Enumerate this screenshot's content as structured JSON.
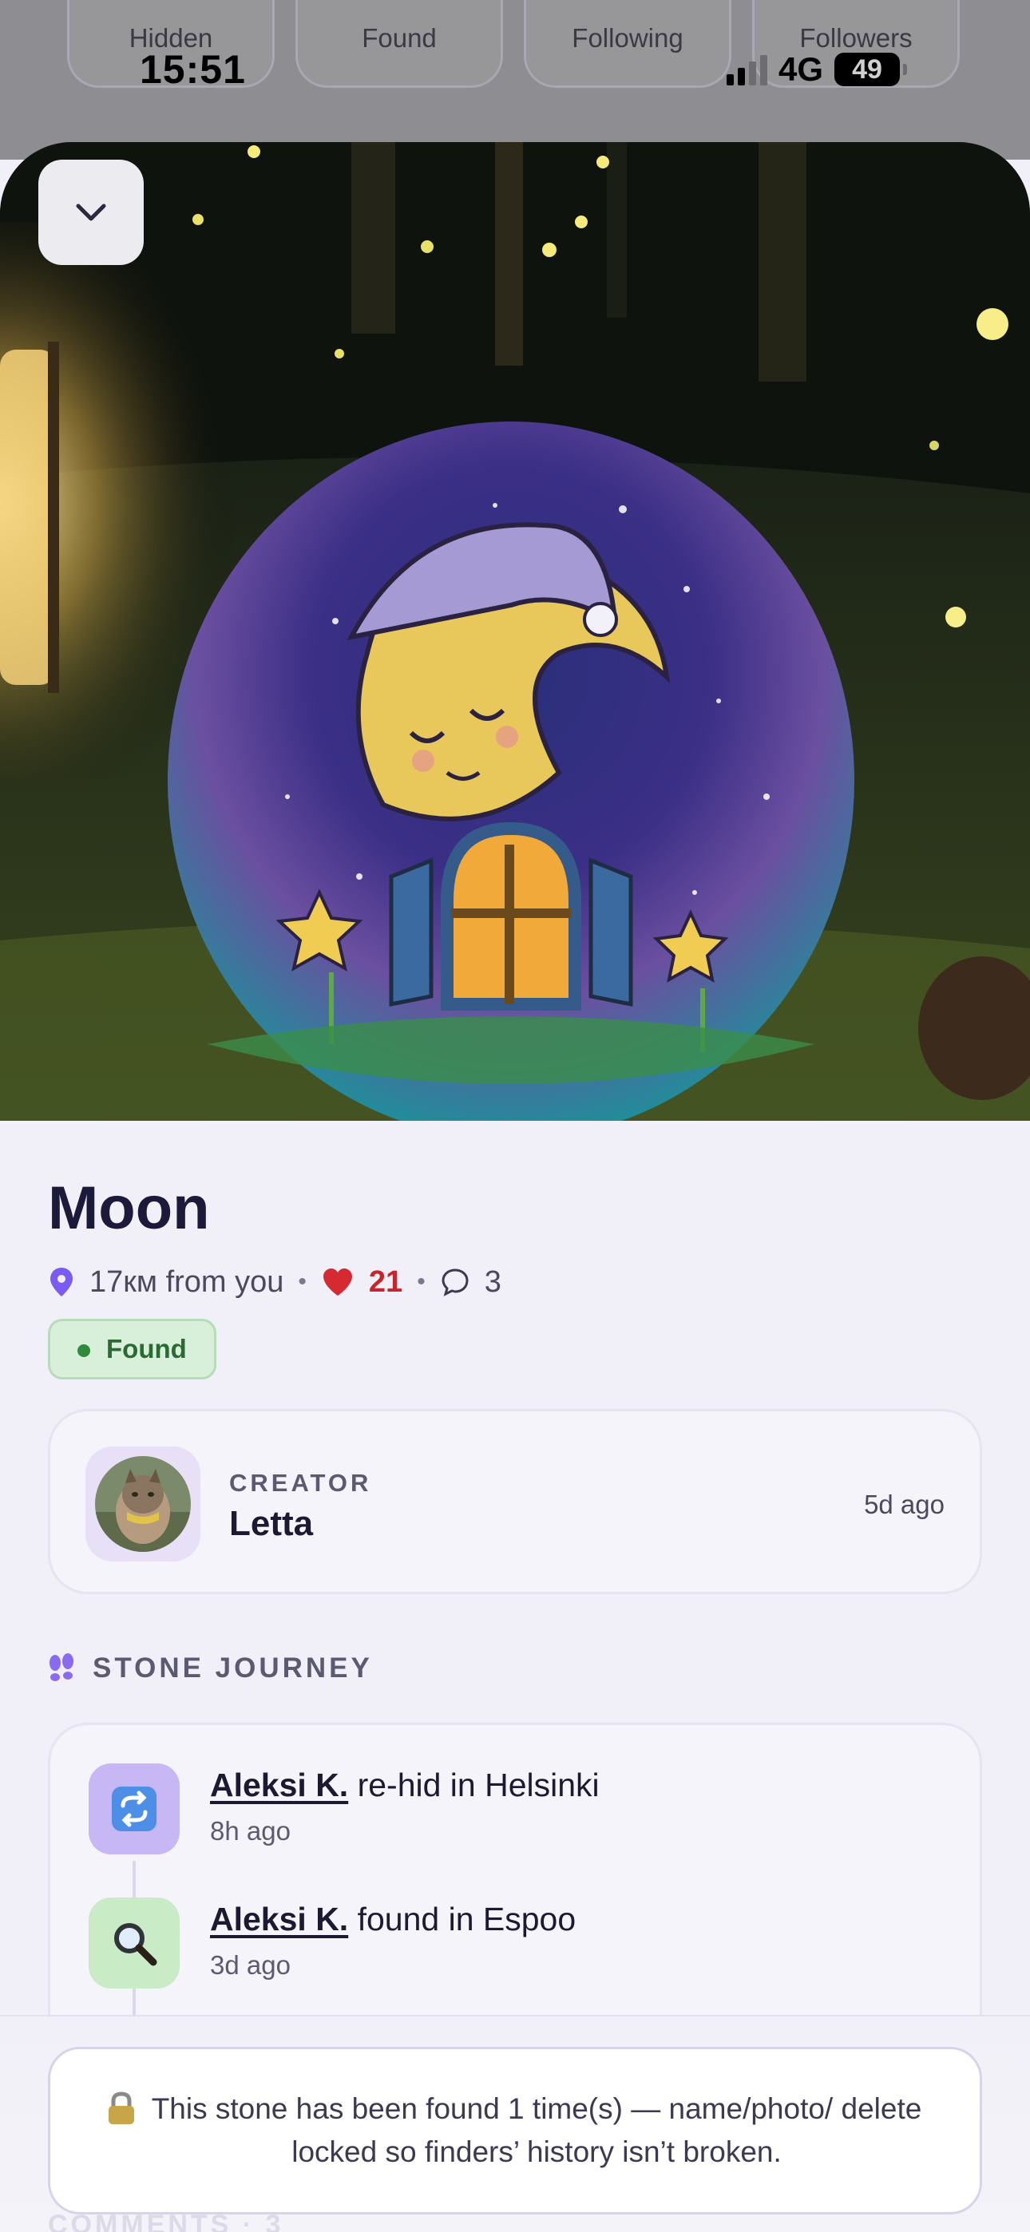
{
  "status_bar": {
    "time": "15:51",
    "network": "4G",
    "battery": "49"
  },
  "background_stats": [
    "Hidden",
    "Found",
    "Following",
    "Followers"
  ],
  "stone": {
    "title": "Moon",
    "distance": "17км from you",
    "likes": "21",
    "comments": "3",
    "status": "Found"
  },
  "creator": {
    "label": "CREATOR",
    "name": "Letta",
    "time": "5d ago"
  },
  "journey": {
    "header": "STONE JOURNEY",
    "events": [
      {
        "actor": "Aleksi K.",
        "action": " re-hid in Helsinki",
        "time": "8h ago",
        "icon": "repeat-icon"
      },
      {
        "actor": "Aleksi K.",
        "action": " found in Espoo",
        "time": "3d ago",
        "icon": "magnifier-icon"
      }
    ]
  },
  "lock_notice": "This stone has been found 1 time(s) — name/photo/ delete locked so finders’ history isn’t broken.",
  "comments_peek": "COMMENTS · 3",
  "colors": {
    "accent_purple": "#7c5cf0",
    "heart_red": "#c8242b",
    "found_green": "#2b6a33"
  }
}
